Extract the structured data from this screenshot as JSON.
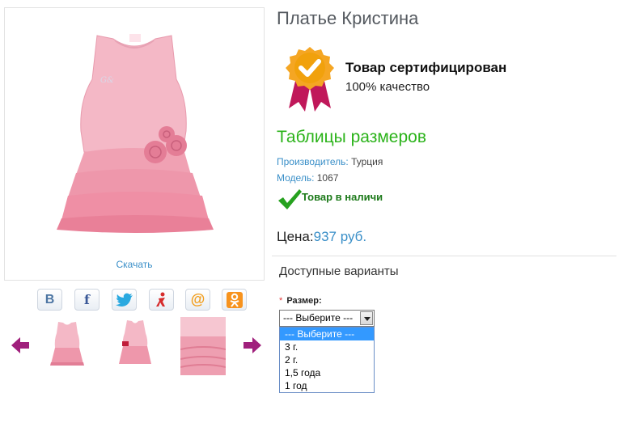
{
  "product": {
    "title": "Платье Кристина",
    "download_label": "Скачать"
  },
  "certificate": {
    "title": "Товар сертифицирован",
    "subtitle": "100% качество",
    "icon": "certified-badge-icon"
  },
  "size_table_link": "Таблицы размеров",
  "specs": {
    "manufacturer_label": "Производитель:",
    "manufacturer_value": "Турция",
    "model_label": "Модель:",
    "model_value": "1067"
  },
  "stock": {
    "text": "Товар в наличи",
    "icon": "checkmark-icon"
  },
  "price": {
    "label": "Цена:",
    "value": "937 руб."
  },
  "variants": {
    "title": "Доступные варианты",
    "size_label": "Размер:",
    "required_mark": "*",
    "selected": "--- Выберите ---",
    "options": [
      "--- Выберите ---",
      "3 г.",
      "2 г.",
      "1,5 года",
      "1 год"
    ]
  },
  "social": [
    {
      "name": "vk",
      "glyph": "B",
      "color": "#4c75a3"
    },
    {
      "name": "facebook",
      "glyph": "f",
      "color": "#3b5998"
    },
    {
      "name": "twitter",
      "glyph": "twitter-bird",
      "color": "#2aa9e0"
    },
    {
      "name": "moikrug",
      "glyph": "moikrug-figure",
      "color": "#d62c2c"
    },
    {
      "name": "mailru",
      "glyph": "@",
      "color": "#f29d1b"
    },
    {
      "name": "odnoklassniki",
      "glyph": "ok-figure",
      "color": "#f7931e"
    }
  ],
  "colors": {
    "accent_blue": "#3a8fc8",
    "accent_green": "#2bb31a",
    "arrow_purple": "#a0207c"
  }
}
